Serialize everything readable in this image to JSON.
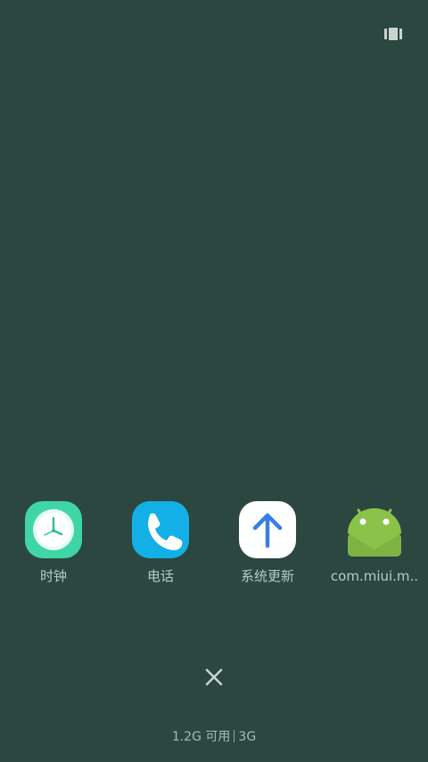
{
  "toolbar": {
    "layout_icon": "view-mode-icon"
  },
  "recent_apps": [
    {
      "label": "时钟",
      "icon": "clock-icon"
    },
    {
      "label": "电话",
      "icon": "phone-icon"
    },
    {
      "label": "系统更新",
      "icon": "up-arrow-icon"
    },
    {
      "label": "com.miui.m..",
      "icon": "android-icon"
    }
  ],
  "close_icon": "close-icon",
  "memory": {
    "available": "1.2G 可用",
    "total": "3G"
  },
  "colors": {
    "background": "#2b4740",
    "clock_green": "#3fd5a4",
    "phone_blue": "#12b0e6",
    "update_arrow": "#3b7de8",
    "android_green": "#8bc34a"
  }
}
